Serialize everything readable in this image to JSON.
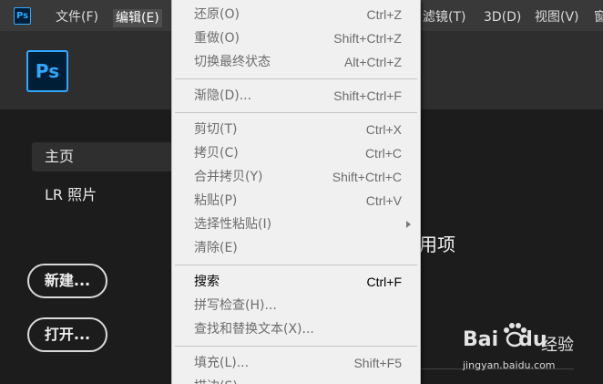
{
  "menubar": {
    "app_icon": "Ps",
    "items": [
      {
        "label": "文件(F)"
      },
      {
        "label": "编辑(E)"
      },
      {
        "label": "滤镜(T)"
      },
      {
        "label": "3D(D)"
      },
      {
        "label": "视图(V)"
      },
      {
        "label": "窗"
      }
    ]
  },
  "home": {
    "logo": "Ps",
    "nav": {
      "home": "主页",
      "lr": "LR 照片"
    },
    "buttons": {
      "new": "新建...",
      "open": "打开..."
    },
    "heading_fragment": "用项"
  },
  "edit_menu": {
    "items": [
      {
        "label": "还原(O)",
        "shortcut": "Ctrl+Z"
      },
      {
        "label": "重做(O)",
        "shortcut": "Shift+Ctrl+Z"
      },
      {
        "label": "切换最终状态",
        "shortcut": "Alt+Ctrl+Z"
      },
      {
        "label": "渐隐(D)...",
        "shortcut": "Shift+Ctrl+F"
      },
      {
        "label": "剪切(T)",
        "shortcut": "Ctrl+X"
      },
      {
        "label": "拷贝(C)",
        "shortcut": "Ctrl+C"
      },
      {
        "label": "合并拷贝(Y)",
        "shortcut": "Shift+Ctrl+C"
      },
      {
        "label": "粘贴(P)",
        "shortcut": "Ctrl+V"
      },
      {
        "label": "选择性粘贴(I)",
        "shortcut": ""
      },
      {
        "label": "清除(E)",
        "shortcut": ""
      },
      {
        "label": "搜索",
        "shortcut": "Ctrl+F"
      },
      {
        "label": "拼写检查(H)...",
        "shortcut": ""
      },
      {
        "label": "查找和替换文本(X)...",
        "shortcut": ""
      },
      {
        "label": "填充(L)...",
        "shortcut": "Shift+F5"
      },
      {
        "label": "描边(S)...",
        "shortcut": ""
      }
    ]
  },
  "watermark": {
    "logo_left": "Bai",
    "logo_right": "du",
    "jingyan": "经验",
    "url": "jingyan.baidu.com"
  }
}
